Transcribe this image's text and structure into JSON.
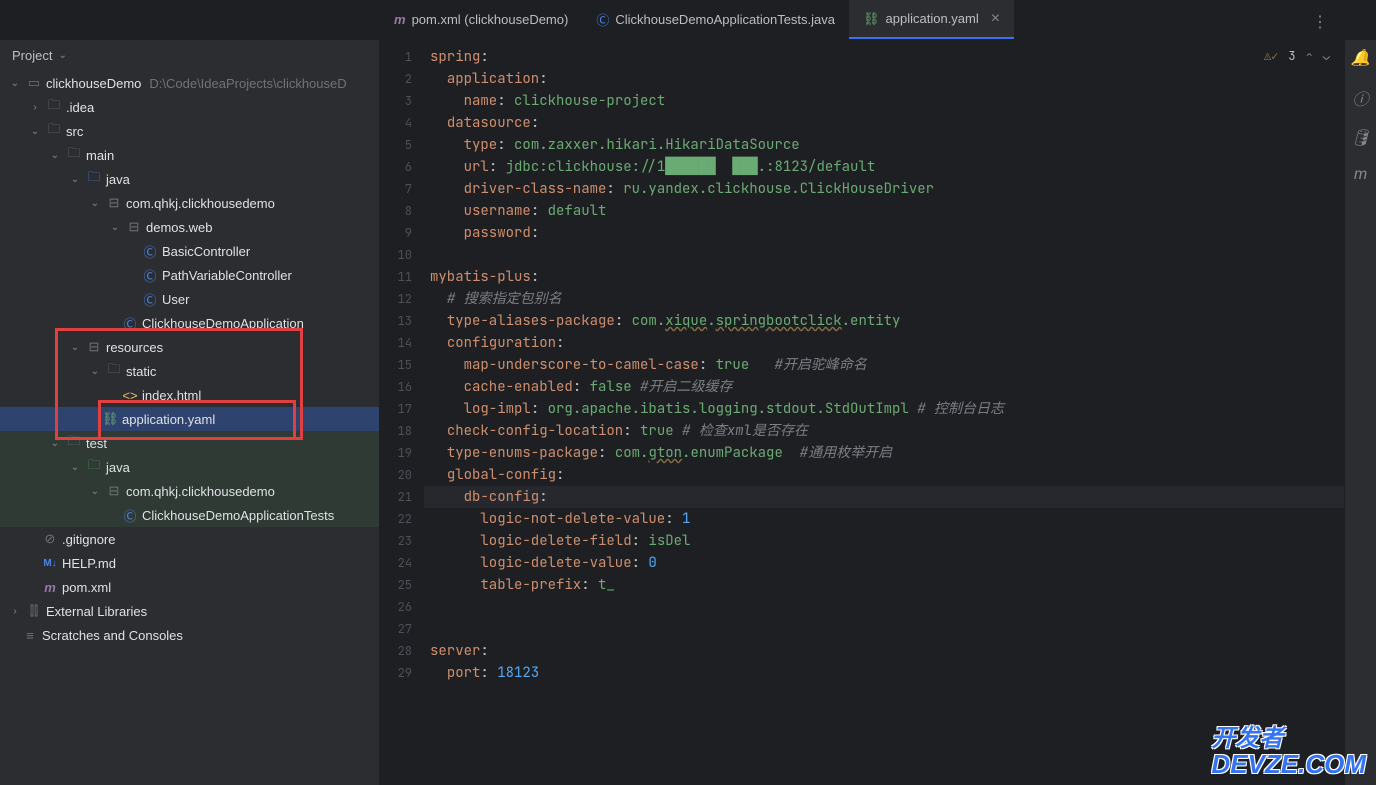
{
  "panel_title": "Project",
  "tree": {
    "root": "clickhouseDemo",
    "root_path": "D:\\Code\\IdeaProjects\\clickhouseD",
    "idea": ".idea",
    "src": "src",
    "main": "main",
    "java": "java",
    "pkg": "com.qhkj.clickhousedemo",
    "demos_web": "demos.web",
    "basic_controller": "BasicController",
    "path_variable_controller": "PathVariableController",
    "user": "User",
    "clickhouse_demo_app": "ClickhouseDemoApplication",
    "resources": "resources",
    "static": "static",
    "index_html": "index.html",
    "application_yaml": "application.yaml",
    "test": "test",
    "test_java": "java",
    "test_pkg": "com.qhkj.clickhousedemo",
    "test_class": "ClickhouseDemoApplicationTests",
    "gitignore": ".gitignore",
    "help_md": "HELP.md",
    "pom_xml": "pom.xml",
    "external_libraries": "External Libraries",
    "scratches": "Scratches and Consoles"
  },
  "tabs": [
    {
      "label": "pom.xml (clickhouseDemo)",
      "active": false,
      "icon": "m"
    },
    {
      "label": "ClickhouseDemoApplicationTests.java",
      "active": false,
      "icon": "c"
    },
    {
      "label": "application.yaml",
      "active": true,
      "icon": "yaml"
    }
  ],
  "inspection": {
    "count": "3"
  },
  "code": [
    {
      "n": 1,
      "content": [
        {
          "t": "spring",
          "c": "y"
        },
        {
          "t": ":",
          "c": ""
        }
      ]
    },
    {
      "n": 2,
      "content": [
        {
          "t": "  ",
          "c": ""
        },
        {
          "t": "application",
          "c": "y"
        },
        {
          "t": ":",
          "c": ""
        }
      ]
    },
    {
      "n": 3,
      "content": [
        {
          "t": "    ",
          "c": ""
        },
        {
          "t": "name",
          "c": "y"
        },
        {
          "t": ": ",
          "c": ""
        },
        {
          "t": "clickhouse-project",
          "c": "s"
        }
      ]
    },
    {
      "n": 4,
      "content": [
        {
          "t": "  ",
          "c": ""
        },
        {
          "t": "datasource",
          "c": "y"
        },
        {
          "t": ":",
          "c": ""
        }
      ]
    },
    {
      "n": 5,
      "content": [
        {
          "t": "    ",
          "c": ""
        },
        {
          "t": "type",
          "c": "y"
        },
        {
          "t": ": ",
          "c": ""
        },
        {
          "t": "com.zaxxer.hikari.HikariDataSource",
          "c": "s"
        }
      ]
    },
    {
      "n": 6,
      "content": [
        {
          "t": "    ",
          "c": ""
        },
        {
          "t": "url",
          "c": "y"
        },
        {
          "t": ": ",
          "c": ""
        },
        {
          "t": "jdbc:clickhouse://1",
          "c": "s"
        },
        {
          "t": "██████  ███",
          "c": "s"
        },
        {
          "t": ".:8123/default",
          "c": "s"
        }
      ]
    },
    {
      "n": 7,
      "content": [
        {
          "t": "    ",
          "c": ""
        },
        {
          "t": "driver-class-name",
          "c": "y"
        },
        {
          "t": ": ",
          "c": ""
        },
        {
          "t": "ru.yandex.clickhouse.ClickHouseDriver",
          "c": "s"
        }
      ]
    },
    {
      "n": 8,
      "content": [
        {
          "t": "    ",
          "c": ""
        },
        {
          "t": "username",
          "c": "y"
        },
        {
          "t": ": ",
          "c": ""
        },
        {
          "t": "default",
          "c": "s"
        }
      ]
    },
    {
      "n": 9,
      "content": [
        {
          "t": "    ",
          "c": ""
        },
        {
          "t": "password",
          "c": "y"
        },
        {
          "t": ":",
          "c": ""
        }
      ]
    },
    {
      "n": 10,
      "content": []
    },
    {
      "n": 11,
      "content": [
        {
          "t": "mybatis-plus",
          "c": "y"
        },
        {
          "t": ":",
          "c": ""
        }
      ]
    },
    {
      "n": 12,
      "content": [
        {
          "t": "  ",
          "c": ""
        },
        {
          "t": "# 搜索指定包别名",
          "c": "c"
        }
      ]
    },
    {
      "n": 13,
      "content": [
        {
          "t": "  ",
          "c": ""
        },
        {
          "t": "type-aliases-package",
          "c": "y"
        },
        {
          "t": ": ",
          "c": ""
        },
        {
          "t": "com.",
          "c": "s"
        },
        {
          "t": "xique",
          "c": "s warn"
        },
        {
          "t": ".",
          "c": "s"
        },
        {
          "t": "springbootclick",
          "c": "s warn"
        },
        {
          "t": ".entity",
          "c": "s"
        }
      ]
    },
    {
      "n": 14,
      "content": [
        {
          "t": "  ",
          "c": ""
        },
        {
          "t": "configuration",
          "c": "y"
        },
        {
          "t": ":",
          "c": ""
        }
      ]
    },
    {
      "n": 15,
      "content": [
        {
          "t": "    ",
          "c": ""
        },
        {
          "t": "map-underscore-to-camel-case",
          "c": "y"
        },
        {
          "t": ": ",
          "c": ""
        },
        {
          "t": "true",
          "c": "s"
        },
        {
          "t": "   ",
          "c": ""
        },
        {
          "t": "#开启驼峰命名",
          "c": "c"
        }
      ]
    },
    {
      "n": 16,
      "content": [
        {
          "t": "    ",
          "c": ""
        },
        {
          "t": "cache-enabled",
          "c": "y"
        },
        {
          "t": ": ",
          "c": ""
        },
        {
          "t": "false",
          "c": "s"
        },
        {
          "t": " ",
          "c": ""
        },
        {
          "t": "#开启二级缓存",
          "c": "c"
        }
      ]
    },
    {
      "n": 17,
      "content": [
        {
          "t": "    ",
          "c": ""
        },
        {
          "t": "log-impl",
          "c": "y"
        },
        {
          "t": ": ",
          "c": ""
        },
        {
          "t": "org.apache.ibatis.logging.stdout.StdOutImpl",
          "c": "s"
        },
        {
          "t": " ",
          "c": ""
        },
        {
          "t": "# 控制台日志",
          "c": "c"
        }
      ]
    },
    {
      "n": 18,
      "content": [
        {
          "t": "  ",
          "c": ""
        },
        {
          "t": "check-config-location",
          "c": "y"
        },
        {
          "t": ": ",
          "c": ""
        },
        {
          "t": "true",
          "c": "s"
        },
        {
          "t": " ",
          "c": ""
        },
        {
          "t": "# 检查xml是否存在",
          "c": "c"
        }
      ]
    },
    {
      "n": 19,
      "content": [
        {
          "t": "  ",
          "c": ""
        },
        {
          "t": "type-enums-package",
          "c": "y"
        },
        {
          "t": ": ",
          "c": ""
        },
        {
          "t": "com.",
          "c": "s"
        },
        {
          "t": "gton",
          "c": "s warn"
        },
        {
          "t": ".enumPackage",
          "c": "s"
        },
        {
          "t": "  ",
          "c": ""
        },
        {
          "t": "#通用枚举开启",
          "c": "c"
        }
      ]
    },
    {
      "n": 20,
      "content": [
        {
          "t": "  ",
          "c": ""
        },
        {
          "t": "global-config",
          "c": "y"
        },
        {
          "t": ":",
          "c": ""
        }
      ]
    },
    {
      "n": 21,
      "current": true,
      "content": [
        {
          "t": "    ",
          "c": ""
        },
        {
          "t": "db-config",
          "c": "y"
        },
        {
          "t": ":",
          "c": ""
        }
      ]
    },
    {
      "n": 22,
      "content": [
        {
          "t": "      ",
          "c": ""
        },
        {
          "t": "logic-not-delete-value",
          "c": "y"
        },
        {
          "t": ": ",
          "c": ""
        },
        {
          "t": "1",
          "c": "n"
        }
      ]
    },
    {
      "n": 23,
      "content": [
        {
          "t": "      ",
          "c": ""
        },
        {
          "t": "logic-delete-field",
          "c": "y"
        },
        {
          "t": ": ",
          "c": ""
        },
        {
          "t": "isDel",
          "c": "s"
        }
      ]
    },
    {
      "n": 24,
      "content": [
        {
          "t": "      ",
          "c": ""
        },
        {
          "t": "logic-delete-value",
          "c": "y"
        },
        {
          "t": ": ",
          "c": ""
        },
        {
          "t": "0",
          "c": "n"
        }
      ]
    },
    {
      "n": 25,
      "content": [
        {
          "t": "      ",
          "c": ""
        },
        {
          "t": "table-prefix",
          "c": "y"
        },
        {
          "t": ": ",
          "c": ""
        },
        {
          "t": "t_",
          "c": "s"
        }
      ]
    },
    {
      "n": 26,
      "content": []
    },
    {
      "n": 27,
      "content": []
    },
    {
      "n": 28,
      "content": [
        {
          "t": "server",
          "c": "y"
        },
        {
          "t": ":",
          "c": ""
        }
      ]
    },
    {
      "n": 29,
      "content": [
        {
          "t": "  ",
          "c": ""
        },
        {
          "t": "port",
          "c": "y"
        },
        {
          "t": ": ",
          "c": ""
        },
        {
          "t": "18123",
          "c": "n"
        }
      ]
    }
  ],
  "watermark": {
    "zh": "开发者",
    "en": "DEVZE.COM"
  }
}
